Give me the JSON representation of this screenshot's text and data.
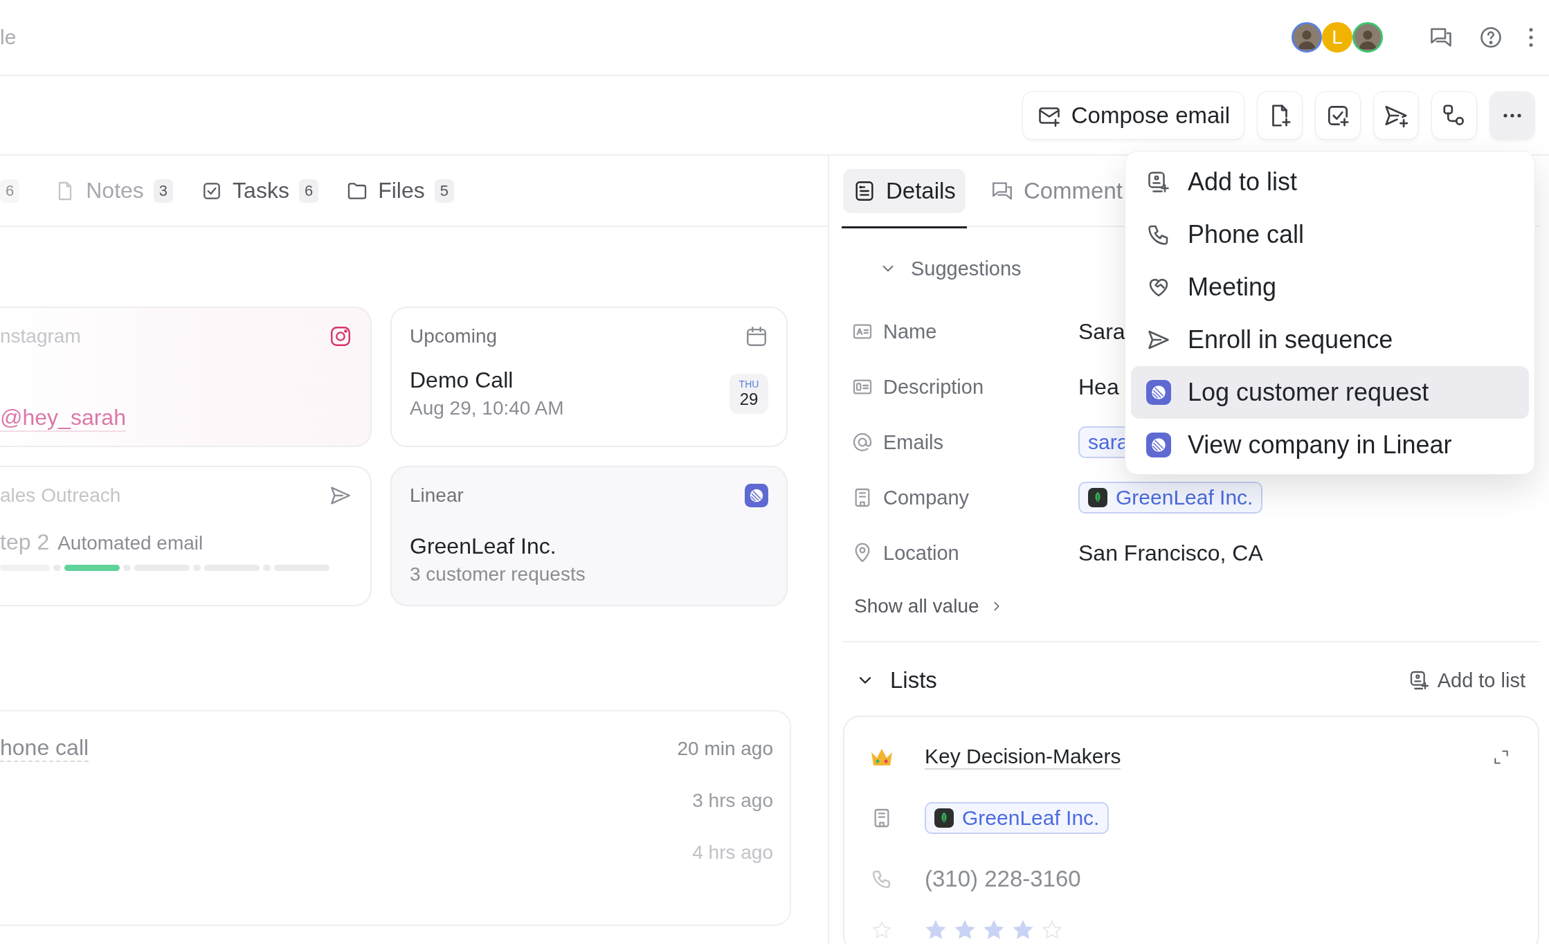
{
  "topbar": {
    "faded_title": "le",
    "avatars": [
      {
        "kind": "photo",
        "color": "#5b7fe0"
      },
      {
        "kind": "initial",
        "initial": "L",
        "color": "#f0b400"
      },
      {
        "kind": "photo",
        "color": "#3cc46f"
      }
    ]
  },
  "toolbar": {
    "primary_button": "Compose email",
    "icon_buttons": [
      {
        "kind": "note"
      },
      {
        "kind": "task"
      },
      {
        "kind": "sequence"
      },
      {
        "kind": "workflow"
      }
    ],
    "more_button": {
      "active": true
    }
  },
  "record_tabs": [
    {
      "kind": "faded",
      "count": "6"
    },
    {
      "kind": "note",
      "label": "Notes",
      "count": "3"
    },
    {
      "kind": "task",
      "label": "Tasks",
      "count": "6"
    },
    {
      "kind": "folder",
      "label": "Files",
      "count": "5"
    }
  ],
  "cards": [
    {
      "kind": "instagram",
      "title": "nstagram",
      "handle": "@hey_sarah"
    },
    {
      "kind": "upcoming",
      "title": "Upcoming",
      "event": "Demo Call",
      "when": "Aug 29, 10:40 AM",
      "day": "THU",
      "date": "29"
    },
    {
      "kind": "sequence",
      "title": "ales Outreach",
      "step": "tep 2",
      "step_label": "Automated email",
      "steps": [
        {
          "current": false
        },
        {
          "current": true
        },
        {
          "current": false
        },
        {
          "current": false
        },
        {
          "current": false
        }
      ]
    },
    {
      "kind": "linear",
      "title": "Linear",
      "company": "GreenLeaf Inc.",
      "requests": "3 customer requests"
    }
  ],
  "history": [
    {
      "title": "hone call",
      "time": "20 min ago"
    },
    {
      "time": "3 hrs ago"
    },
    {
      "time": "4 hrs ago"
    }
  ],
  "detail_tabs": [
    {
      "kind": "details",
      "label": "Details",
      "selected": true
    },
    {
      "kind": "comment",
      "label": "Comment",
      "selected": false
    }
  ],
  "suggestions": {
    "label": "Suggestions",
    "expanded": true
  },
  "fields": [
    {
      "kind": "name",
      "label": "Name",
      "value": "Sara"
    },
    {
      "kind": "description",
      "label": "Description",
      "value": "Hea"
    },
    {
      "kind": "email",
      "label": "Emails",
      "chip": "sara"
    },
    {
      "kind": "company",
      "label": "Company",
      "chip": "GreenLeaf Inc."
    },
    {
      "kind": "location",
      "label": "Location",
      "value": "San Francisco, CA"
    }
  ],
  "show_all": "Show all value",
  "lists": {
    "title": "Lists",
    "expanded": true,
    "add_button": "Add to list",
    "entry": {
      "name": "Key Decision-Makers",
      "company": "GreenLeaf Inc.",
      "phone": "(310) 228-3160",
      "stars": 4
    }
  },
  "menu": [
    {
      "kind": "add-list",
      "label": "Add to list",
      "selected": false
    },
    {
      "kind": "phone",
      "label": "Phone call",
      "selected": false
    },
    {
      "kind": "meeting",
      "label": "Meeting",
      "selected": false
    },
    {
      "kind": "sequence",
      "label": "Enroll in sequence",
      "selected": false
    },
    {
      "kind": "linear",
      "label": "Log customer request",
      "selected": true
    },
    {
      "kind": "linear",
      "label": "View company in Linear",
      "selected": false
    }
  ]
}
